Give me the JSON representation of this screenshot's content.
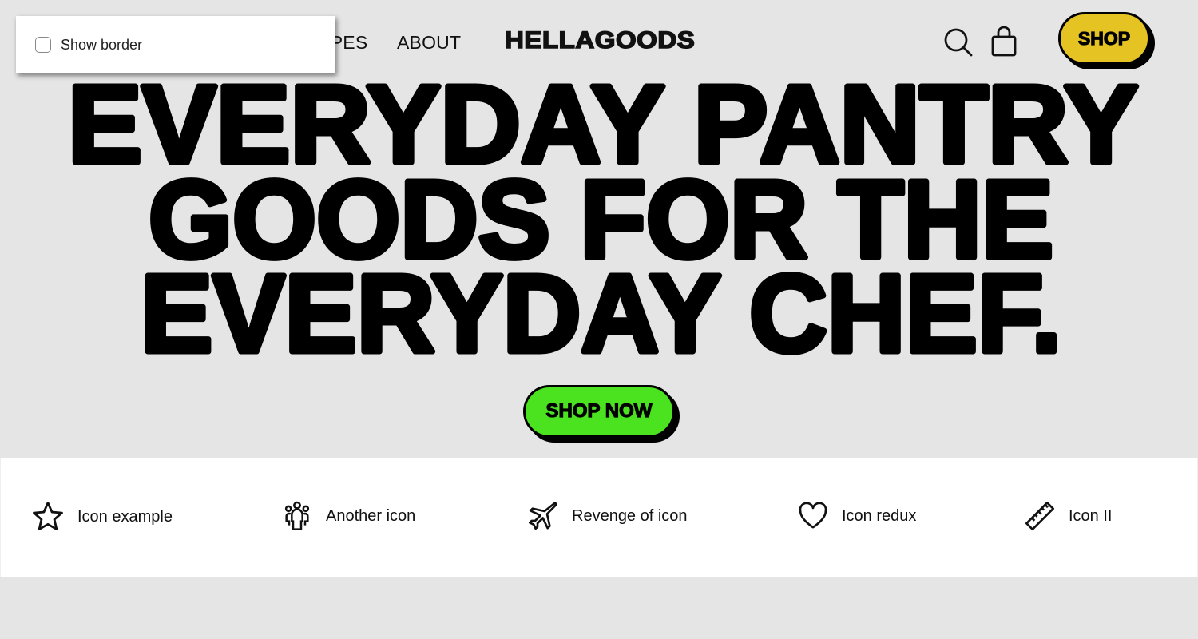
{
  "nav": {
    "links": [
      "RECIPES",
      "ABOUT"
    ],
    "logo": "HELLAGOODS",
    "shop_label": "SHOP",
    "icons": [
      "search-icon",
      "shopping-bag-icon"
    ]
  },
  "hero": {
    "lines": [
      "EVERYDAY PANTRY",
      "GOODS FOR THE",
      "EVERYDAY CHEF."
    ],
    "cta_label": "SHOP NOW"
  },
  "popup": {
    "checkbox_label": "Show border",
    "checked": false
  },
  "features": [
    {
      "icon": "star-icon",
      "label": "Icon example"
    },
    {
      "icon": "people-icon",
      "label": "Another icon"
    },
    {
      "icon": "airplane-icon",
      "label": "Revenge of icon"
    },
    {
      "icon": "heart-icon",
      "label": "Icon redux"
    },
    {
      "icon": "ruler-icon",
      "label": "Icon II"
    }
  ],
  "colors": {
    "background": "#e5e5e5",
    "shop": "#e5c323",
    "shop_now": "#4be31f"
  }
}
